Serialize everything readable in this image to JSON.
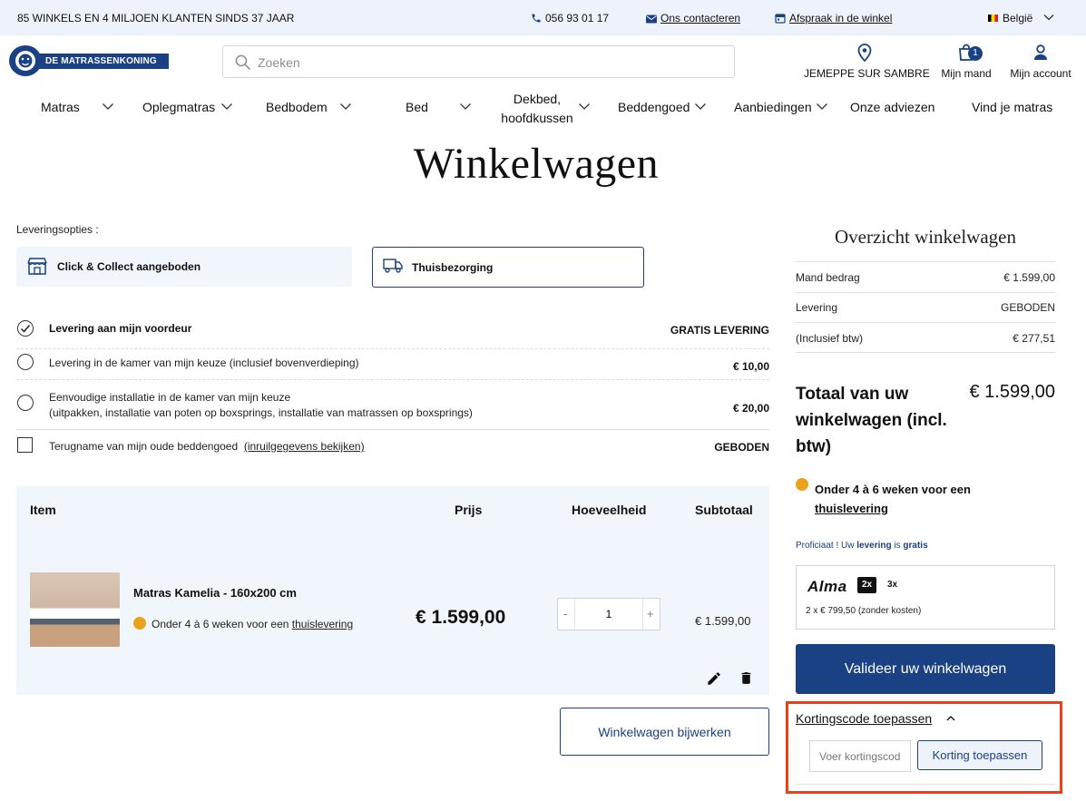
{
  "topbar": {
    "tagline": "85 WINKELS EN 4 MILJOEN KLANTEN SINDS 37 JAAR",
    "phone": "056 93 01 17",
    "contact": "Ons contacteren",
    "appointment": "Afspraak in de winkel",
    "country": "België"
  },
  "header": {
    "logo_text": "DE MATRASSENKONING",
    "search_placeholder": "Zoeken",
    "store": "JEMEPPE SUR SAMBRE",
    "cart": "Mijn mand",
    "cart_count": "1",
    "account": "Mijn account"
  },
  "nav": {
    "matras": "Matras",
    "oplegmatras": "Oplegmatras",
    "bedbodem": "Bedbodem",
    "bed": "Bed",
    "dekbed_1": "Dekbed,",
    "dekbed_2": "hoofdkussen",
    "beddengoed": "Beddengoed",
    "aanbiedingen": "Aanbiedingen",
    "adviezen": "Onze adviezen",
    "vind": "Vind je matras"
  },
  "page": {
    "title": "Winkelwagen"
  },
  "delivery": {
    "label": "Leveringsopties :",
    "click_collect": "Click & Collect aangeboden",
    "home_delivery": "Thuisbezorging",
    "options": [
      {
        "label": "Levering aan mijn voordeur",
        "price": "GRATIS LEVERING"
      },
      {
        "label": "Levering in de kamer van mijn keuze (inclusief bovenverdieping)",
        "price": "€ 10,00"
      },
      {
        "label": "Eenvoudige installatie in de kamer van mijn keuze",
        "label2": "(uitpakken, installatie van poten op boxsprings, installatie van matrassen op boxsprings)",
        "price": "€ 20,00"
      },
      {
        "label": "Terugname van mijn oude beddengoed",
        "link": "(inruilgegevens bekijken)",
        "price": "GEBODEN"
      }
    ]
  },
  "cart": {
    "headers": {
      "item": "Item",
      "price": "Prijs",
      "qty": "Hoeveelheid",
      "subtotal": "Subtotaal"
    },
    "item": {
      "name": "Matras Kamelia - 160x200 cm",
      "delivery_text": "Onder 4 à 6 weken voor een",
      "delivery_link": "thuislevering",
      "price": "€ 1.599,00",
      "qty": "1",
      "subtotal": "€ 1.599,00"
    },
    "minus": "-",
    "plus": "+",
    "update_button": "Winkelwagen bijwerken"
  },
  "summary": {
    "title": "Overzicht winkelwagen",
    "rows": [
      {
        "label": "Mand bedrag",
        "value": "€ 1.599,00"
      },
      {
        "label": "Levering",
        "value": "GEBODEN"
      },
      {
        "label": "(Inclusief btw)",
        "value": "€ 277,51"
      }
    ],
    "total_label": "Totaal van uw winkelwagen (incl. btw)",
    "total_value": "€ 1.599,00",
    "delivery_text": "Onder 4 à 6 weken voor een",
    "delivery_link": "thuislevering",
    "congrats_1": "Proficiaat ! Uw",
    "congrats_2": "levering",
    "congrats_3": "is",
    "congrats_4": "gratis",
    "alma_logo": "Alma",
    "alma_2x": "2x",
    "alma_3x": "3x",
    "alma_detail": "2 x € 799,50 (zonder kosten)",
    "validate_button": "Valideer uw winkelwagen",
    "coupon_toggle": "Kortingscode toepassen",
    "coupon_placeholder": "Voer kortingscode in",
    "coupon_button": "Korting toepassen"
  },
  "colors": {
    "brand": "#1a4183",
    "highlight": "#e8401c",
    "status": "#e9a21a",
    "topbar": "#eef3fb",
    "cart_bg": "#f1f5fc"
  }
}
